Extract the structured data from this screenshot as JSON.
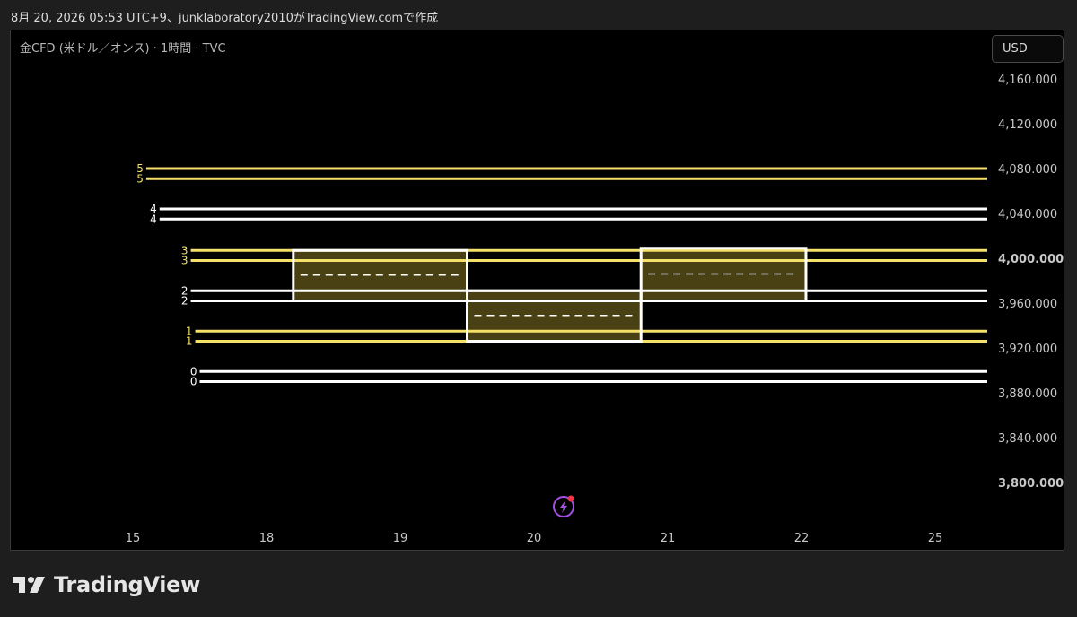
{
  "caption": "8月 20, 2026 05:53 UTC+9、junklaboratory2010がTradingView.comで作成",
  "symbol": "金CFD (米ドル／オンス) · 1時間 · TVC",
  "currency": "USD",
  "brand": "TradingView",
  "colors": {
    "background": "#000000",
    "yellow": "#f5e06a",
    "white": "#ffffff",
    "box_fill": "#4d4514",
    "axis_text": "#c8c8c8",
    "alert_icon": "#a64fe8",
    "alert_dot": "#f23645"
  },
  "chart_data": {
    "type": "annotated-price-chart",
    "y_axis": {
      "ticks": [
        {
          "value": 4160,
          "label": "4,160.000"
        },
        {
          "value": 4120,
          "label": "4,120.000"
        },
        {
          "value": 4080,
          "label": "4,080.000"
        },
        {
          "value": 4040,
          "label": "4,040.000"
        },
        {
          "value": 4000,
          "label": "4,000.000"
        },
        {
          "value": 3960,
          "label": "3,960.000"
        },
        {
          "value": 3920,
          "label": "3,920.000"
        },
        {
          "value": 3880,
          "label": "3,880.000"
        },
        {
          "value": 3840,
          "label": "3,840.000"
        },
        {
          "value": 3800,
          "label": "3,800.000"
        }
      ],
      "ylim": [
        3760,
        4195
      ]
    },
    "x_axis": {
      "ticks": [
        {
          "value": 15,
          "label": "15"
        },
        {
          "value": 18,
          "label": "18"
        },
        {
          "value": 19,
          "label": "19"
        },
        {
          "value": 20,
          "label": "20"
        },
        {
          "value": 21,
          "label": "21"
        },
        {
          "value": 22,
          "label": "22"
        },
        {
          "value": 25,
          "label": "25"
        }
      ]
    },
    "level_lines": [
      {
        "label": "5",
        "value": 4080,
        "color": "yellow",
        "x_start": 15.3
      },
      {
        "label": "5",
        "value": 4071,
        "color": "yellow",
        "x_start": 15.3
      },
      {
        "label": "4",
        "value": 4044,
        "color": "white",
        "x_start": 15.6
      },
      {
        "label": "4",
        "value": 4035,
        "color": "white",
        "x_start": 15.6
      },
      {
        "label": "3",
        "value": 4007,
        "color": "yellow",
        "x_start": 16.3
      },
      {
        "label": "3",
        "value": 3998,
        "color": "yellow",
        "x_start": 16.3
      },
      {
        "label": "2",
        "value": 3971,
        "color": "white",
        "x_start": 16.3
      },
      {
        "label": "2",
        "value": 3962,
        "color": "white",
        "x_start": 16.3
      },
      {
        "label": "1",
        "value": 3935,
        "color": "yellow",
        "x_start": 16.4
      },
      {
        "label": "1",
        "value": 3926,
        "color": "yellow",
        "x_start": 16.4
      },
      {
        "label": "0",
        "value": 3899,
        "color": "white",
        "x_start": 16.5
      },
      {
        "label": "0",
        "value": 3890,
        "color": "white",
        "x_start": 16.5
      }
    ],
    "boxes": [
      {
        "x_start": 18.2,
        "x_end": 19.5,
        "top": 4007,
        "bottom": 3962,
        "mid": 3985
      },
      {
        "x_start": 19.5,
        "x_end": 20.8,
        "top": 3971,
        "bottom": 3926,
        "mid": 3949
      },
      {
        "x_start": 20.8,
        "x_end": 22.1,
        "top": 4009,
        "bottom": 3962,
        "mid": 3986
      }
    ]
  }
}
